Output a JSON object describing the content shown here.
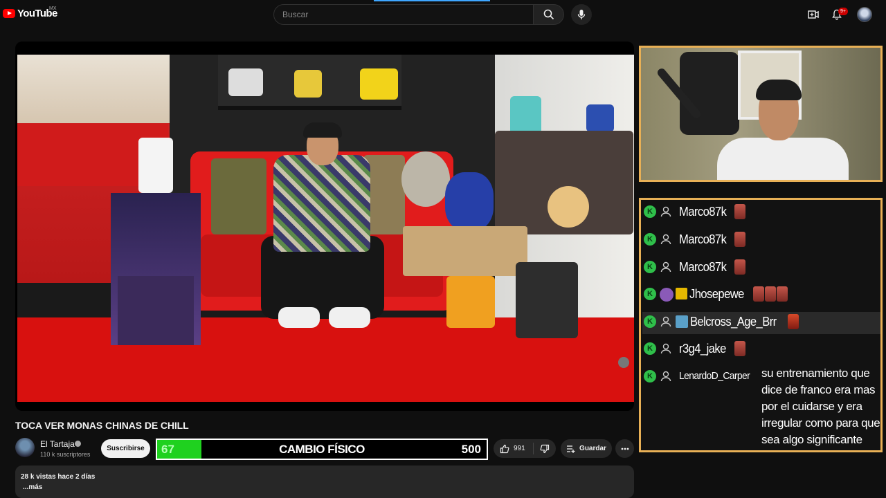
{
  "header": {
    "logo_text": "YouTube",
    "region": "MX",
    "search_placeholder": "Buscar",
    "notification_count": "9+",
    "accent_color": "#ff0000"
  },
  "video": {
    "title": "TOCA VER MONAS CHINAS DE CHILL"
  },
  "channel": {
    "name": "El Tartaja",
    "subscribers": "110 k suscriptores",
    "subscribe_label": "Suscribirse"
  },
  "goal_bar": {
    "current": "67",
    "label": "CAMBIO FÍSICO",
    "max": "500",
    "fill_fraction": 0.134,
    "fill_color": "#1fd11f"
  },
  "actions": {
    "likes": "991",
    "save_label": "Guardar"
  },
  "description": {
    "meta": "28 k vistas  hace 2 días",
    "more_label": "...más"
  },
  "chat": {
    "border_color": "#e8b056",
    "messages": [
      {
        "user": "Marco87k"
      },
      {
        "user": "Marco87k"
      },
      {
        "user": "Marco87k"
      },
      {
        "user": "Jhosepewe"
      },
      {
        "user": "Belcross_Age_Brr"
      },
      {
        "user": "r3g4_jake"
      },
      {
        "user": "LenardoD_Carper",
        "text": "su entrenamiento que dice de franco era mas por el cuidarse y era irregular como para que sea algo significante"
      }
    ]
  }
}
